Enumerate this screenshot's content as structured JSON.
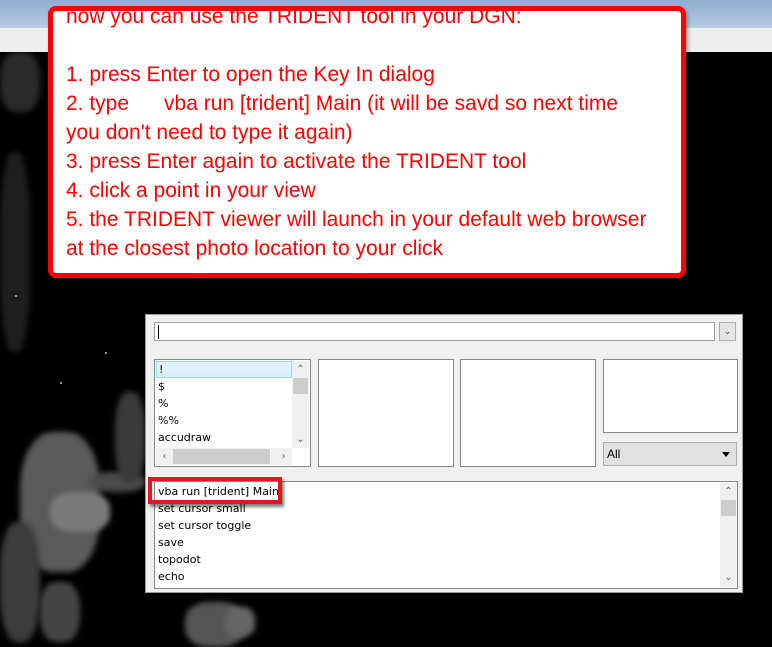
{
  "callout": {
    "lines": [
      "now you can use the TRIDENT tool in your DGN:",
      "",
      "1. press Enter to open the Key In dialog",
      "2. type      vba run [trident] Main (it will be savd so next time",
      "you don't need to type it again)",
      "3. press Enter again to activate the TRIDENT tool",
      "4. click a point in your view",
      "5. the TRIDENT viewer will launch in your default web browser",
      "at the closest photo location to your click"
    ],
    "color": "#ff0000"
  },
  "keyin_dialog": {
    "input_value": "",
    "command_list": [
      "!",
      "$",
      "%",
      "%%",
      "accudraw"
    ],
    "selected_command": "!",
    "filter": {
      "selected": "All"
    },
    "history": [
      "vba run [trident] Main",
      "set cursor small",
      "set cursor toggle",
      "save",
      "topodot",
      "echo"
    ],
    "highlighted_history_item": "vba run [trident] Main",
    "highlight_color": "#e8141a"
  },
  "icons": {
    "dropdown": "chevron-down-icon",
    "scroll_up": "chevron-up-icon",
    "scroll_down": "chevron-down-icon",
    "scroll_left": "chevron-left-icon",
    "scroll_right": "chevron-right-icon",
    "filter_arrow": "triangle-down-icon"
  }
}
